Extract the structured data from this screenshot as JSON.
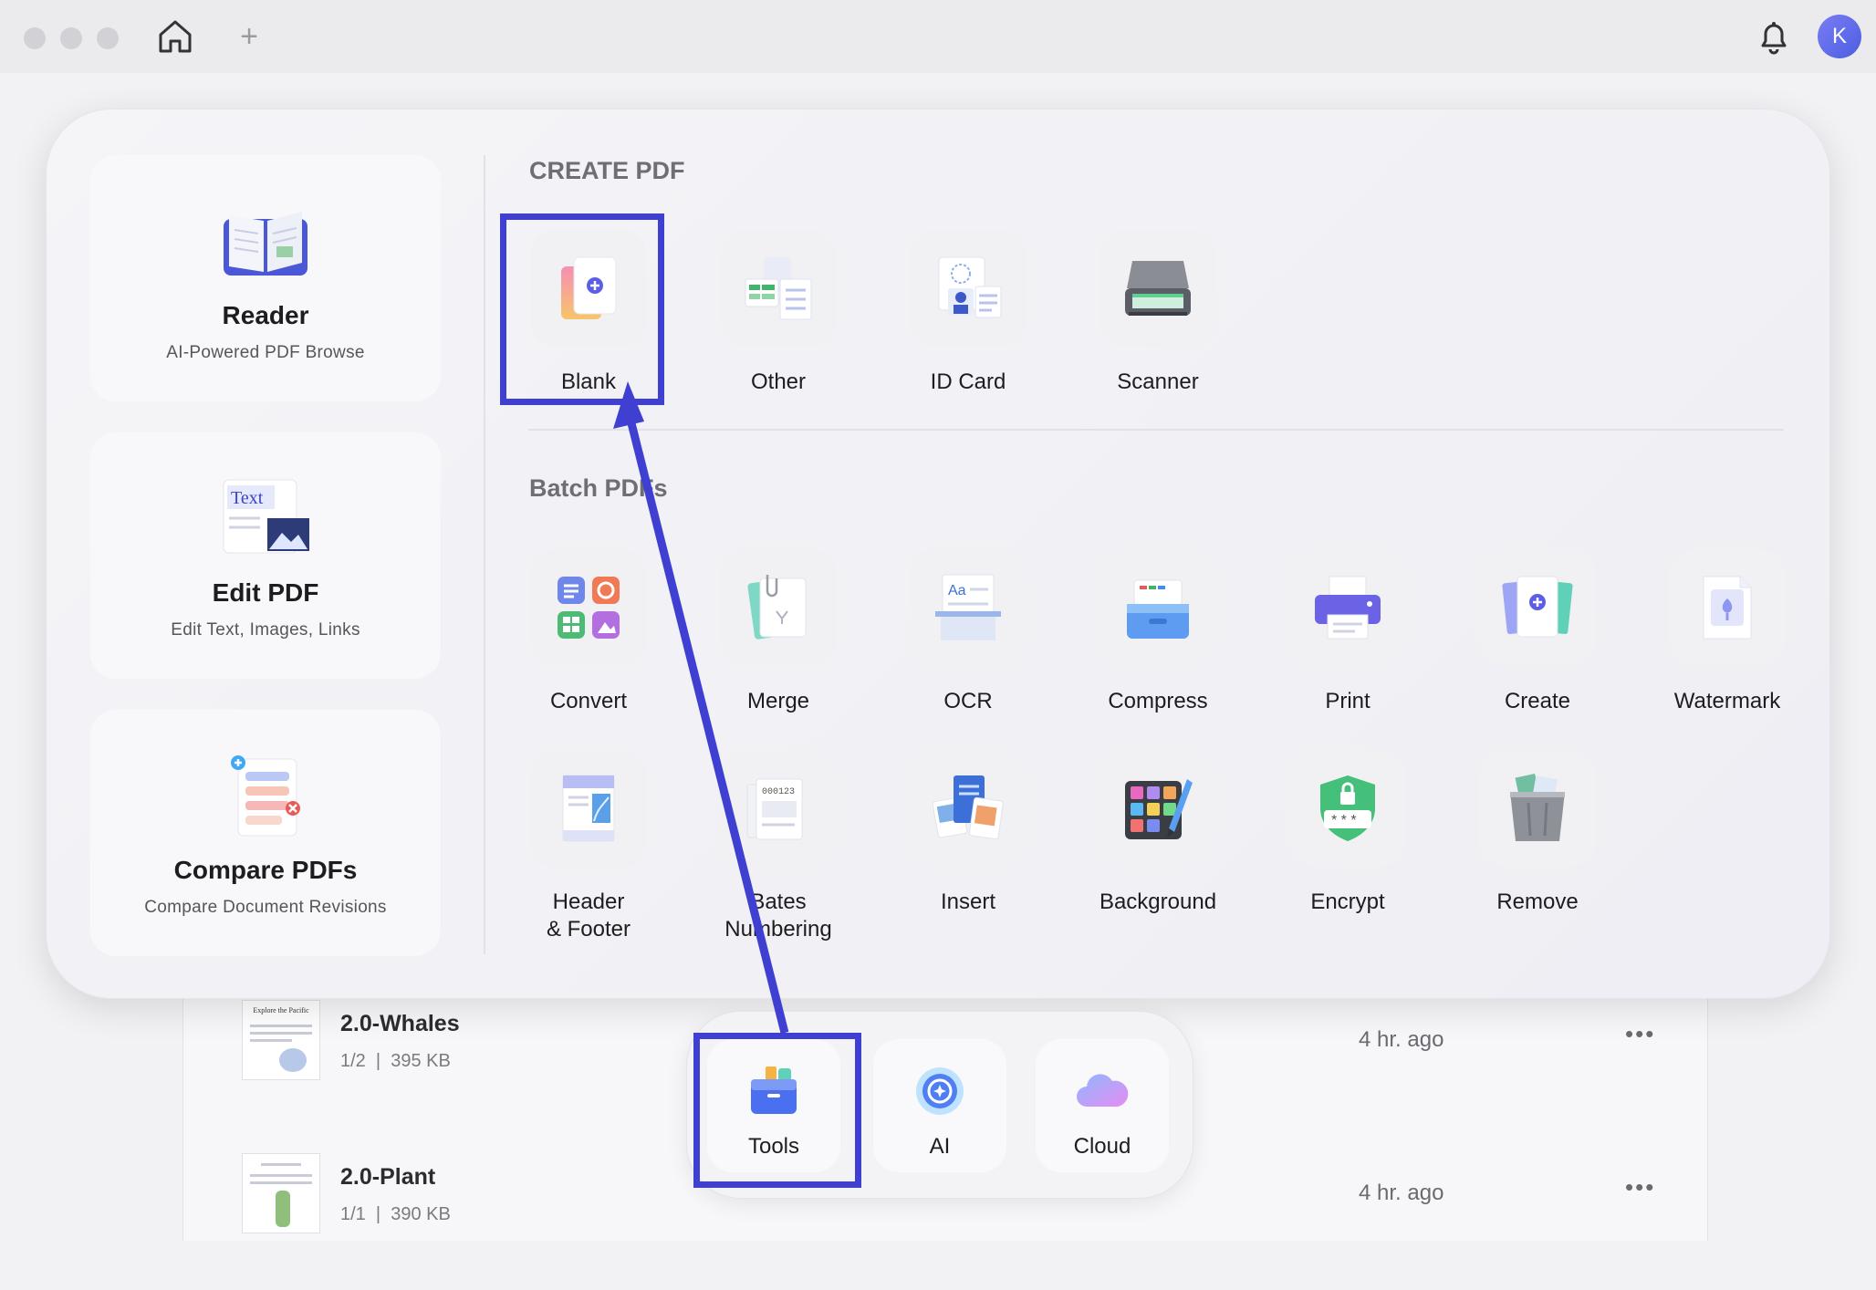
{
  "create_pdf": {
    "title": "CREATE PDF",
    "tools": [
      {
        "label": "Blank",
        "icon": "blank-page-icon"
      },
      {
        "label": "Other",
        "icon": "other-files-icon"
      },
      {
        "label": "ID Card",
        "icon": "id-card-icon"
      },
      {
        "label": "Scanner",
        "icon": "scanner-icon"
      }
    ]
  },
  "batch": {
    "title": "Batch PDFs",
    "tools": [
      {
        "label": "Convert",
        "icon": "convert-icon"
      },
      {
        "label": "Merge",
        "icon": "merge-icon"
      },
      {
        "label": "OCR",
        "icon": "ocr-icon"
      },
      {
        "label": "Compress",
        "icon": "compress-icon"
      },
      {
        "label": "Print",
        "icon": "printer-icon"
      },
      {
        "label": "Create",
        "icon": "create-icon"
      },
      {
        "label": "Watermark",
        "icon": "watermark-icon"
      },
      {
        "label": "Header\n& Footer",
        "icon": "header-footer-icon"
      },
      {
        "label": "Bates\nNumbering",
        "icon": "bates-numbering-icon"
      },
      {
        "label": "Insert",
        "icon": "insert-icon"
      },
      {
        "label": "Background",
        "icon": "background-icon"
      },
      {
        "label": "Encrypt",
        "icon": "encrypt-shield-icon"
      },
      {
        "label": "Remove",
        "icon": "trash-icon"
      }
    ]
  },
  "sidebar": [
    {
      "title": "Reader",
      "subtitle": "AI-Powered PDF Browse",
      "icon": "book-icon"
    },
    {
      "title": "Edit PDF",
      "subtitle": "Edit Text, Images, Links",
      "icon": "edit-text-image-icon",
      "icon_text": "Text"
    },
    {
      "title": "Compare PDFs",
      "subtitle": "Compare Document Revisions",
      "icon": "compare-docs-icon"
    }
  ],
  "dock": [
    {
      "label": "Tools",
      "icon": "toolbox-icon"
    },
    {
      "label": "AI",
      "icon": "ai-orb-icon"
    },
    {
      "label": "Cloud",
      "icon": "cloud-icon"
    }
  ],
  "files": [
    {
      "name": "2.0-Whales",
      "pages": "1/2",
      "size": "395 KB",
      "time": "4 hr. ago",
      "thumb_title": "Explore the Pacific"
    },
    {
      "name": "2.0-Plant",
      "pages": "1/1",
      "size": "390 KB",
      "time": "4 hr. ago"
    }
  ],
  "user": {
    "avatar_initial": "K"
  },
  "colors": {
    "highlight": "#3f3fd1",
    "accent": "#5b5fe6"
  }
}
